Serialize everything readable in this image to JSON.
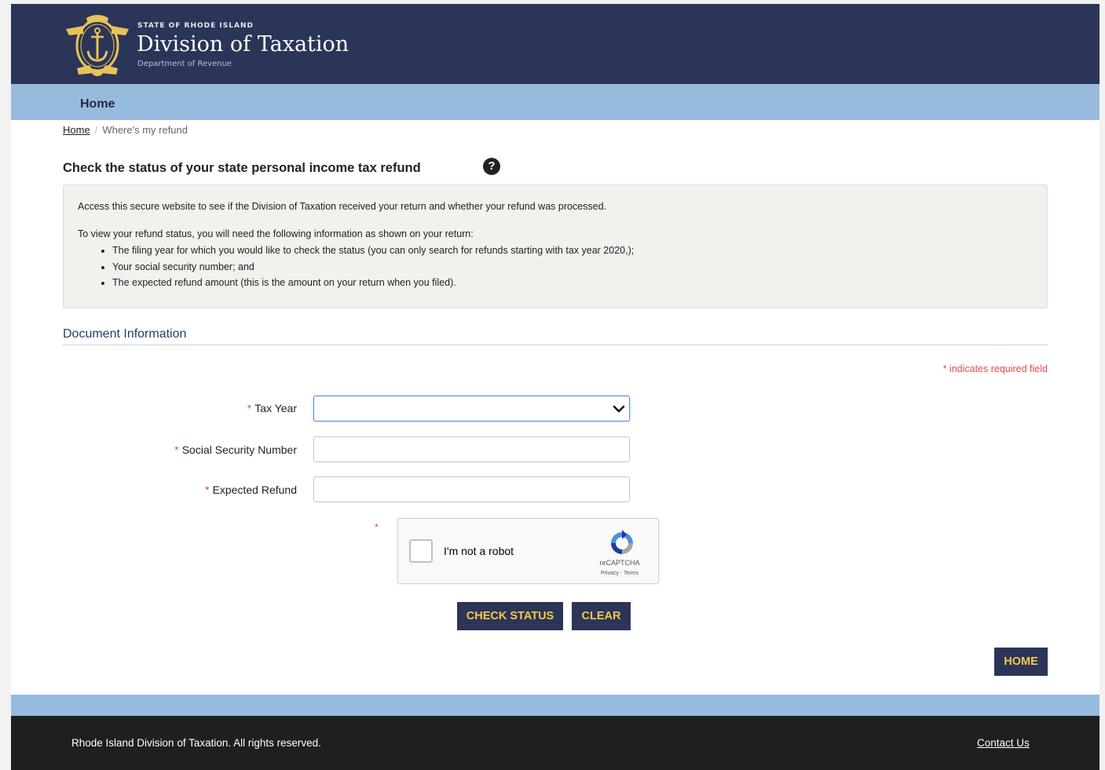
{
  "header": {
    "state": "STATE OF RHODE ISLAND",
    "title": "Division of Taxation",
    "subtitle": "Department of Revenue"
  },
  "nav": {
    "home": "Home"
  },
  "breadcrumb": {
    "home": "Home",
    "separator": "/",
    "current": "Where's my refund"
  },
  "page_title": "Check the status of your state personal income tax refund",
  "help_icon": "question-circle-icon",
  "info": {
    "intro": "Access this secure website to see if the Division of Taxation received your return and whether your refund was processed.",
    "lead": "To view your refund status, you will need the following information as shown on your return:",
    "items": [
      "The filing year for which you would like to check the status (you can only search for refunds starting with tax year 2020,);",
      "Your social security number; and",
      "The expected refund amount (this is the amount on your return when you filed)."
    ]
  },
  "section": {
    "title": "Document Information",
    "required_note": "* indicates required field"
  },
  "form": {
    "required_mark": "*",
    "tax_year_label": "Tax Year",
    "tax_year_value": "",
    "ssn_label": "Social Security Number",
    "ssn_value": "",
    "refund_label": "Expected Refund",
    "refund_value": ""
  },
  "captcha": {
    "label": "I'm not a robot",
    "brand": "reCAPTCHA",
    "links": "Privacy - Terms"
  },
  "buttons": {
    "check_status": "CHECK STATUS",
    "clear": "CLEAR",
    "home": "HOME"
  },
  "footer": {
    "copyright": "Rhode Island Division of Taxation. All rights reserved.",
    "contact": "Contact Us"
  },
  "colors": {
    "header_bg": "#2a3558",
    "nav_bg": "#97bbdf",
    "button_text": "#f7c948",
    "required": "#d9534f",
    "footer_bg": "#1f1f1f"
  }
}
